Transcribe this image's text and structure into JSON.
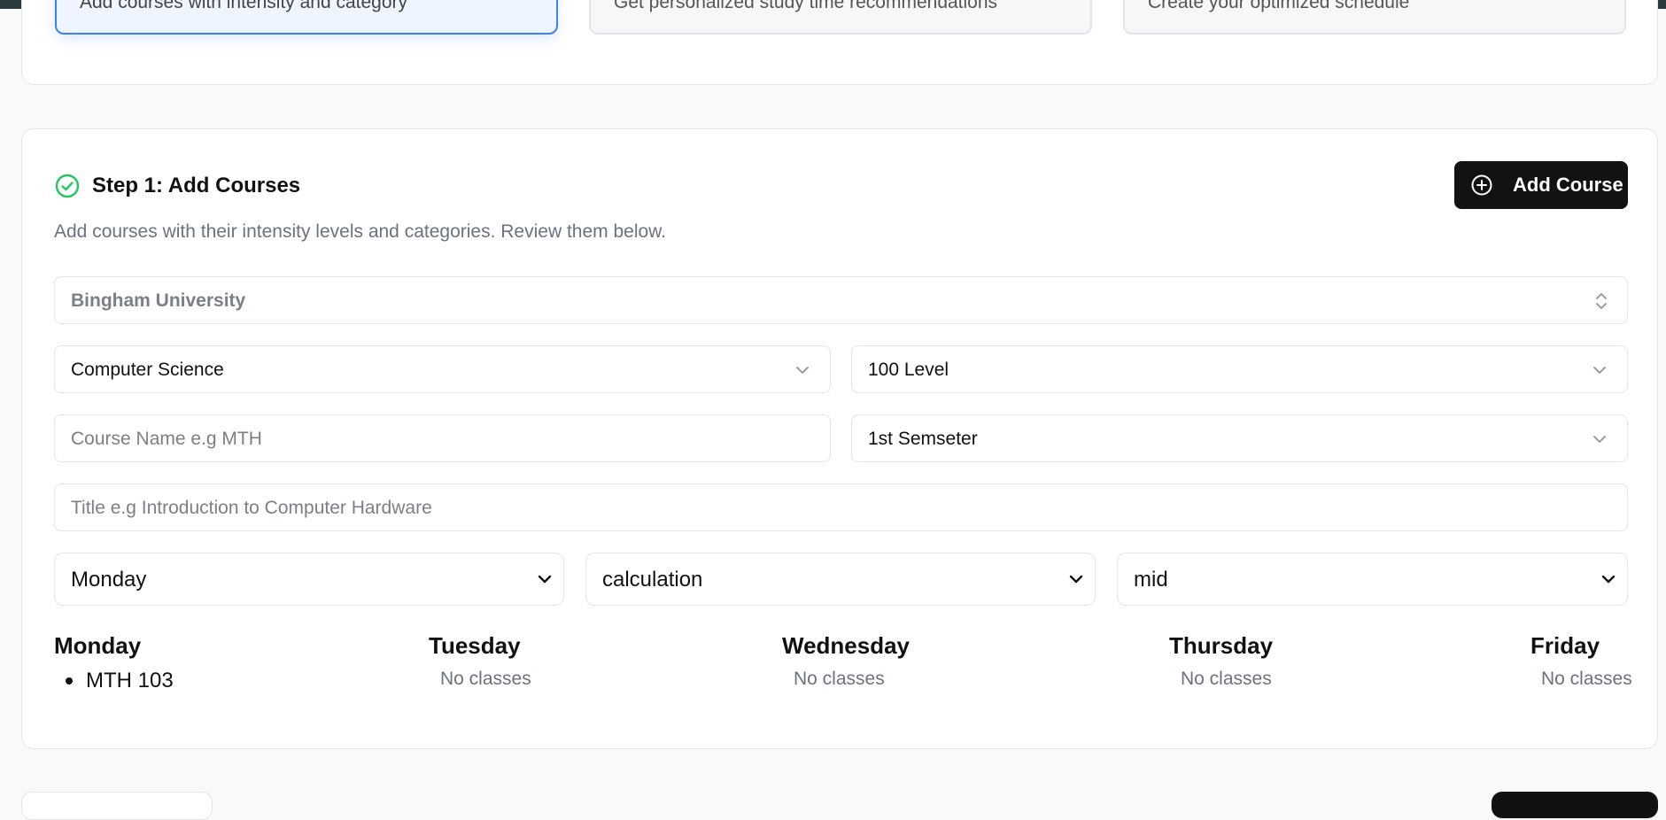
{
  "steps": [
    {
      "label": "Add courses with intensity and category",
      "active": true
    },
    {
      "label": "Get personalized study time recommendations",
      "active": false
    },
    {
      "label": "Create your optimized schedule",
      "active": false
    }
  ],
  "section": {
    "title": "Step 1: Add Courses",
    "description": "Add courses with their intensity levels and categories. Review them below.",
    "add_button_label": "Add Course"
  },
  "form": {
    "university": {
      "value": "Bingham University"
    },
    "department": {
      "value": "Computer Science"
    },
    "level": {
      "value": "100 Level"
    },
    "course_name": {
      "placeholder": "Course Name e.g MTH"
    },
    "semester": {
      "value": "1st Semseter"
    },
    "title": {
      "placeholder": "Title e.g Introduction to Computer Hardware"
    },
    "day": {
      "value": "Monday"
    },
    "category": {
      "value": "calculation"
    },
    "intensity": {
      "value": "mid"
    }
  },
  "schedule": {
    "days": [
      {
        "name": "Monday",
        "items": [
          "MTH 103"
        ]
      },
      {
        "name": "Tuesday",
        "empty_text": "No classes"
      },
      {
        "name": "Wednesday",
        "empty_text": "No classes"
      },
      {
        "name": "Thursday",
        "empty_text": "No classes"
      },
      {
        "name": "Friday",
        "empty_text": "No classes"
      }
    ]
  },
  "colors": {
    "accent": "#3b82f6",
    "success": "#22c55e",
    "primary_button": "#121212"
  },
  "icons": {
    "check": "check-circle-icon",
    "add": "plus-circle-icon",
    "select": "chevron-down-icon",
    "combobox": "chevrons-up-down-icon"
  }
}
